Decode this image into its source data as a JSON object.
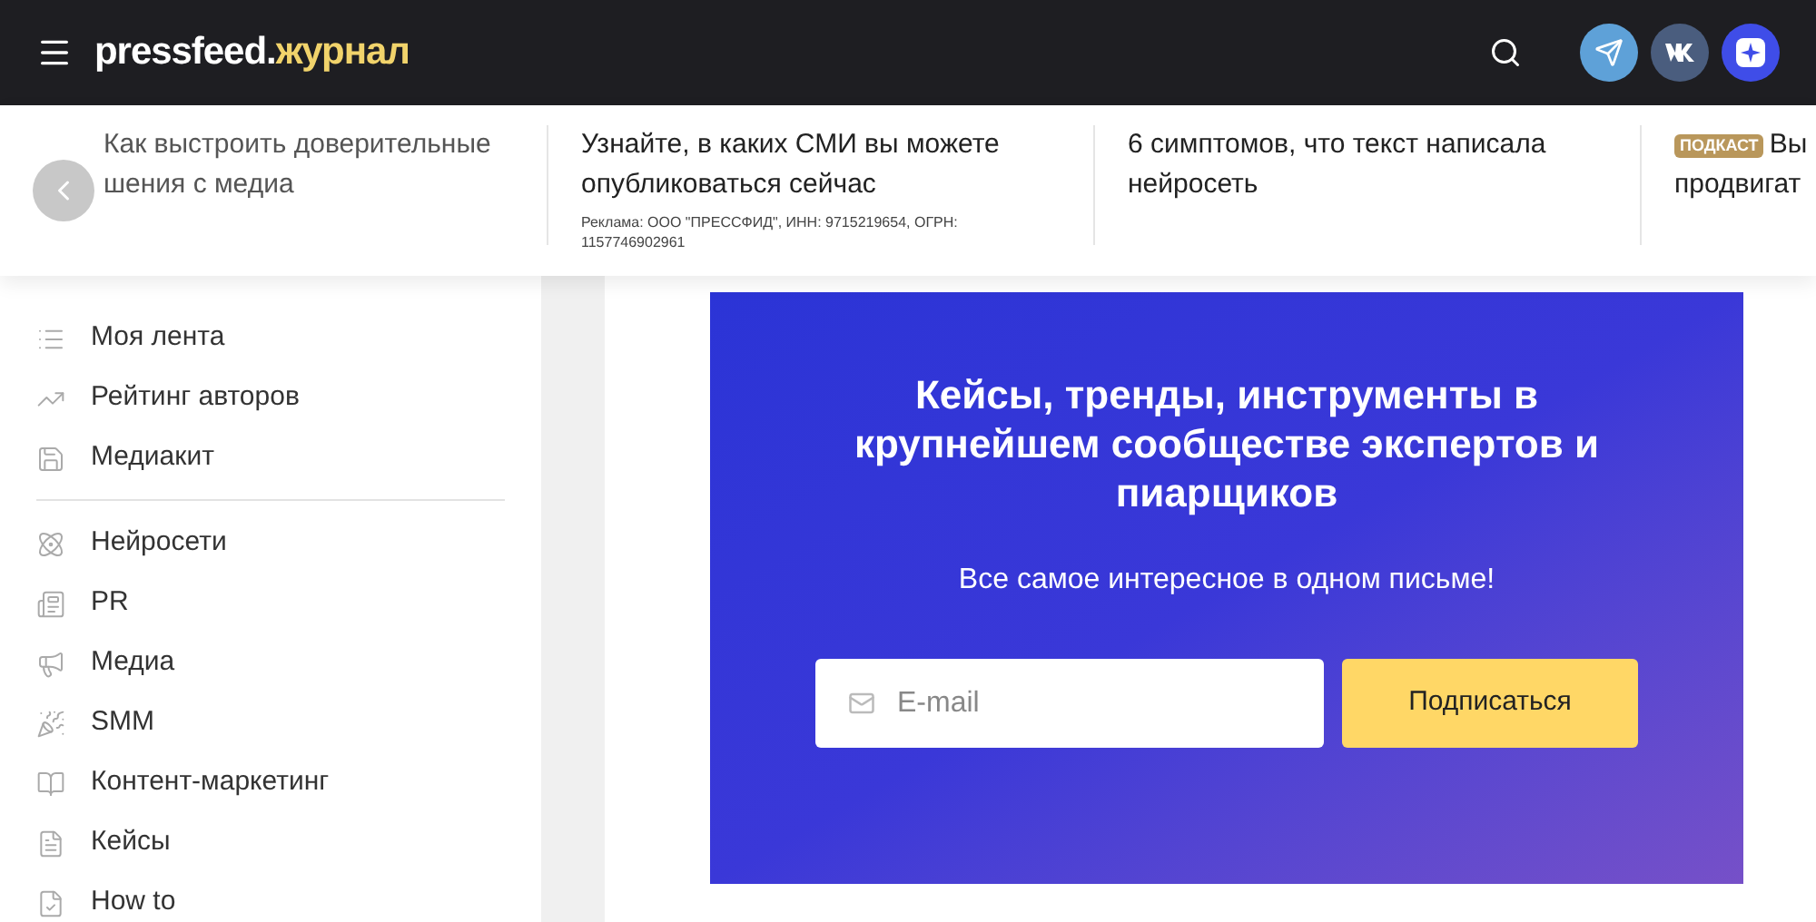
{
  "header": {
    "logo_main": "pressfeed.",
    "logo_accent": "журнал"
  },
  "ticker": [
    {
      "lines": [
        "Как выстроить доверительные",
        "шения с медиа"
      ],
      "faded": true
    },
    {
      "lines": [
        "Узнайте, в каких СМИ вы можете",
        "опубликоваться сейчас"
      ],
      "faded": false,
      "ad_note": "Реклама: ООО \"ПРЕССФИД\", ИНН: 9715219654, ОГРН: 1157746902961"
    },
    {
      "lines": [
        "6 симптомов, что текст написала",
        "нейросеть"
      ],
      "faded": false
    },
    {
      "lines": [
        "Вы",
        "продвигат"
      ],
      "faded": false,
      "badge": "ПОДКАСТ"
    }
  ],
  "sidebar": {
    "groups": [
      [
        {
          "label": "Моя лента"
        },
        {
          "label": "Рейтинг авторов"
        },
        {
          "label": "Медиакит"
        }
      ],
      [
        {
          "label": "Нейросети"
        },
        {
          "label": "PR"
        },
        {
          "label": "Медиа"
        },
        {
          "label": "SMM"
        },
        {
          "label": "Контент-маркетинг"
        },
        {
          "label": "Кейсы"
        },
        {
          "label": "How to"
        }
      ]
    ]
  },
  "banner": {
    "title": "Кейсы, тренды, инструменты в крупнейшем сообществе экспертов и пиарщиков",
    "subtitle": "Все самое интересное в одном письме!",
    "email_placeholder": "E-mail",
    "button": "Подписаться"
  }
}
